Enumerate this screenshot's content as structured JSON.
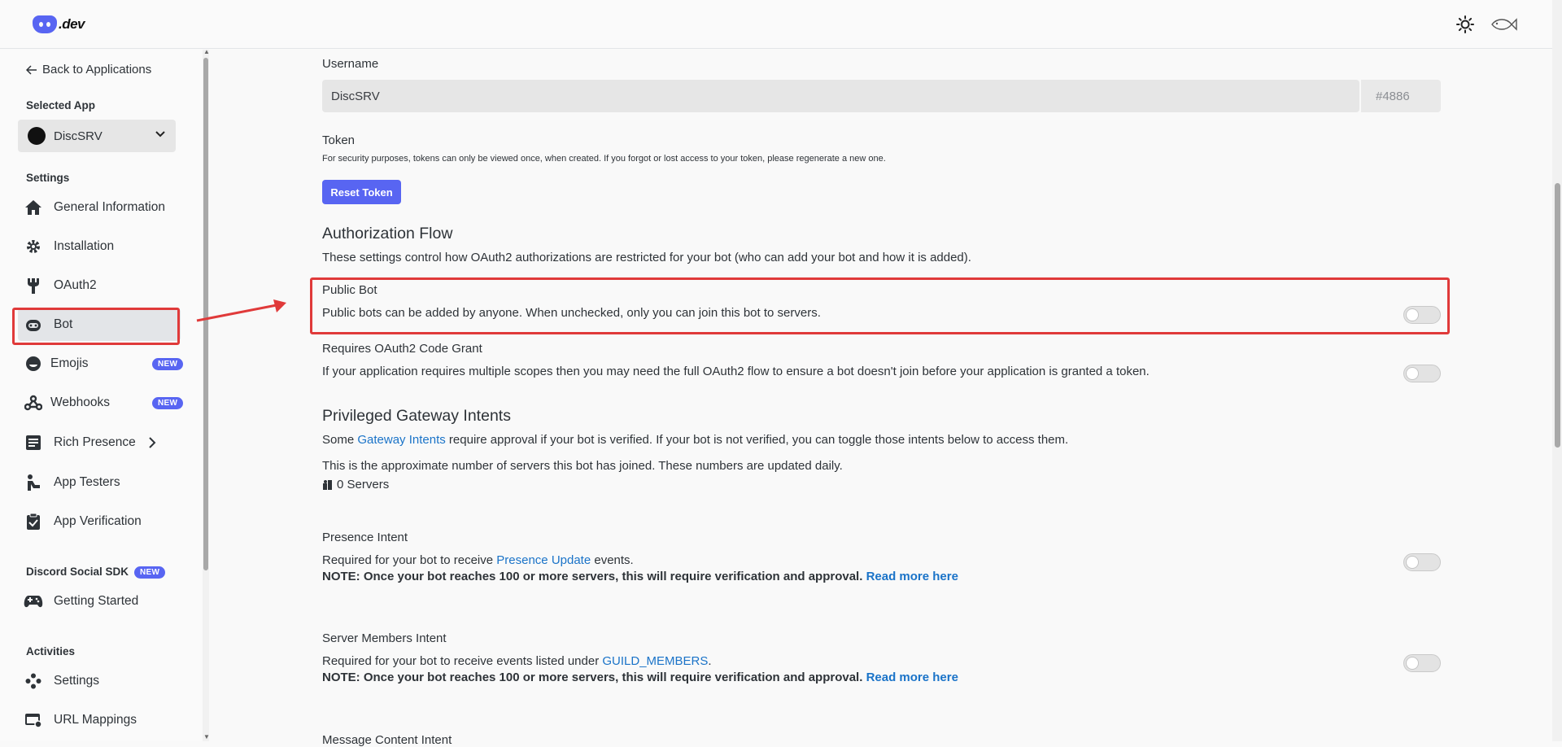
{
  "topbar": {
    "logo_text": ".dev",
    "theme_icon": "sun-icon",
    "profile_icon": "fish-icon"
  },
  "sidebar": {
    "back_label": "Back to Applications",
    "selected_app_heading": "Selected App",
    "selected_app_name": "DiscSRV",
    "settings_heading": "Settings",
    "items": [
      {
        "label": "General Information",
        "icon": "home-icon"
      },
      {
        "label": "Installation",
        "icon": "gear-icon"
      },
      {
        "label": "OAuth2",
        "icon": "wrench-icon"
      },
      {
        "label": "Bot",
        "icon": "bot-icon"
      },
      {
        "label": "Emojis",
        "icon": "smile-icon",
        "badge": "NEW"
      },
      {
        "label": "Webhooks",
        "icon": "webhook-icon",
        "badge": "NEW"
      },
      {
        "label": "Rich Presence",
        "icon": "document-icon"
      },
      {
        "label": "App Testers",
        "icon": "person-icon"
      },
      {
        "label": "App Verification",
        "icon": "clipboard-check-icon"
      }
    ],
    "social_sdk_heading": "Discord Social SDK",
    "social_sdk_badge": "NEW",
    "social_items": [
      {
        "label": "Getting Started",
        "icon": "gamepad-icon"
      }
    ],
    "activities_heading": "Activities",
    "activity_items": [
      {
        "label": "Settings",
        "icon": "activity-settings-icon"
      },
      {
        "label": "URL Mappings",
        "icon": "url-mappings-icon"
      }
    ]
  },
  "main": {
    "username_label": "Username",
    "username_value": "DiscSRV",
    "discriminator": "#4886",
    "token_label": "Token",
    "token_help": "For security purposes, tokens can only be viewed once, when created. If you forgot or lost access to your token, please regenerate a new one.",
    "reset_token_label": "Reset Token",
    "auth_flow_heading": "Authorization Flow",
    "auth_flow_desc": "These settings control how OAuth2 authorizations are restricted for your bot (who can add your bot and how it is added).",
    "public_bot_label": "Public Bot",
    "public_bot_desc": "Public bots can be added by anyone. When unchecked, only you can join this bot to servers.",
    "public_bot_enabled": false,
    "code_grant_label": "Requires OAuth2 Code Grant",
    "code_grant_desc": "If your application requires multiple scopes then you may need the full OAuth2 flow to ensure a bot doesn't join before your application is granted a token.",
    "code_grant_enabled": false,
    "intents_heading": "Privileged Gateway Intents",
    "intents_desc_prefix": "Some ",
    "intents_desc_link": "Gateway Intents",
    "intents_desc_suffix": " require approval if your bot is verified. If your bot is not verified, you can toggle those intents below to access them.",
    "servers_note": "This is the approximate number of servers this bot has joined. These numbers are updated daily.",
    "servers_count": "0 Servers",
    "presence_label": "Presence Intent",
    "presence_desc_prefix": "Required for your bot to receive ",
    "presence_desc_link": "Presence Update",
    "presence_desc_suffix": " events.",
    "presence_note": "NOTE: Once your bot reaches 100 or more servers, this will require verification and approval.",
    "presence_read_more": "Read more here",
    "presence_enabled": false,
    "members_label": "Server Members Intent",
    "members_desc_prefix": "Required for your bot to receive events listed under ",
    "members_desc_link": "GUILD_MEMBERS",
    "members_desc_suffix": ".",
    "members_note": "NOTE: Once your bot reaches 100 or more servers, this will require verification and approval.",
    "members_read_more": "Read more here",
    "members_enabled": false,
    "message_content_label": "Message Content Intent"
  },
  "colors": {
    "accent": "#5865f2",
    "link": "#1a73c8",
    "highlight": "#e03a3a"
  }
}
